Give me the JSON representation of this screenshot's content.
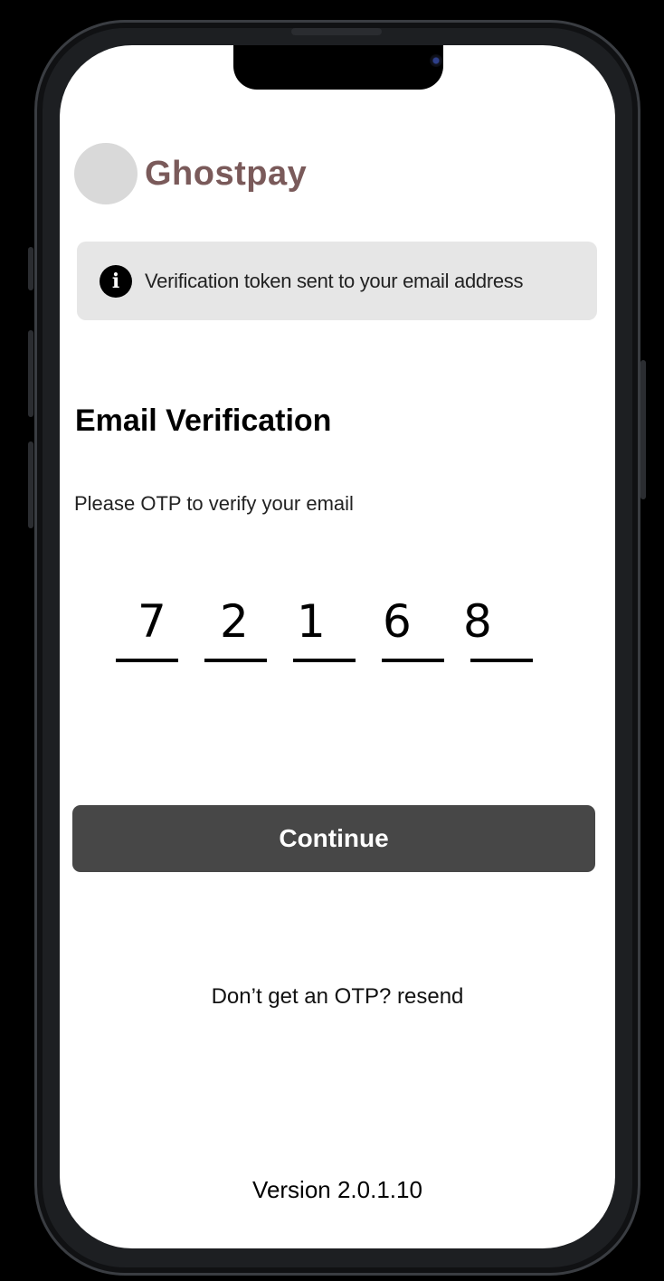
{
  "app": {
    "brand_name": "Ghostpay",
    "brand_color": "#7a5a5a"
  },
  "info_banner": {
    "icon": "info-icon",
    "icon_glyph": "i",
    "message": "Verification token sent to your email address"
  },
  "verification": {
    "title": "Email Verification",
    "subtitle": "Please OTP to verify your email",
    "otp_digits": [
      "7",
      "2",
      "1",
      "6",
      "8"
    ]
  },
  "actions": {
    "continue_label": "Continue",
    "continue_color": "#474747",
    "resend_text": "Don’t get an OTP? resend"
  },
  "footer": {
    "version": "Version 2.0.1.10"
  }
}
